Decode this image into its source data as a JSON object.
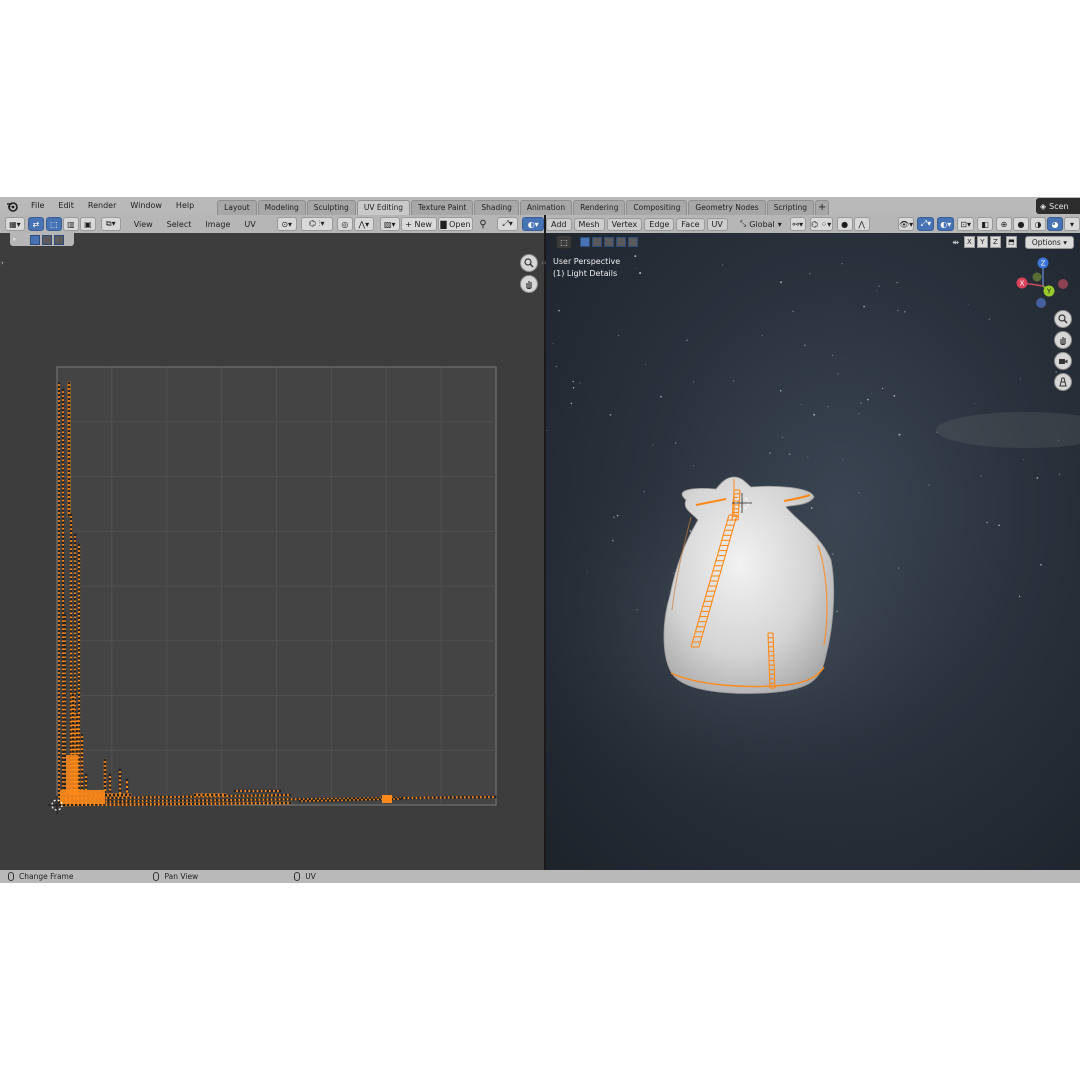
{
  "topbar": {
    "menus": [
      "File",
      "Edit",
      "Render",
      "Window",
      "Help"
    ],
    "tabs": [
      "Layout",
      "Modeling",
      "Sculpting",
      "UV Editing",
      "Texture Paint",
      "Shading",
      "Animation",
      "Rendering",
      "Compositing",
      "Geometry Nodes",
      "Scripting"
    ],
    "active_tab": "UV Editing",
    "scene_label": "Scen"
  },
  "uv_editor": {
    "menus": [
      "View",
      "Select",
      "Image",
      "UV"
    ],
    "new_label": "New",
    "open_label": "Open"
  },
  "viewport": {
    "menus": [
      "Add",
      "Mesh",
      "Vertex",
      "Edge",
      "Face",
      "UV"
    ],
    "transform_orientation": "Global",
    "overlay_line1": "User Perspective",
    "overlay_line2": "(1) Light Details",
    "axes": [
      "X",
      "Y",
      "Z"
    ],
    "options_label": "Options",
    "gizmo_labels": {
      "x": "X",
      "y": "Y",
      "z": "Z"
    }
  },
  "statusbar": {
    "items": [
      "Change Frame",
      "Pan View",
      "UV"
    ]
  },
  "colors": {
    "accent_blue": "#4772b3",
    "uv_orange": "#ff8a1a",
    "header_grey": "#b6b6b6",
    "uv_bg": "#3d3d3d"
  }
}
